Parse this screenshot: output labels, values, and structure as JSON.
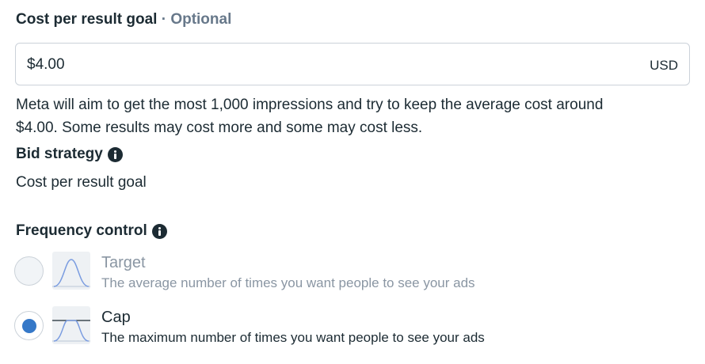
{
  "cost_goal": {
    "label": "Cost per result goal",
    "separator": "·",
    "optional": "Optional",
    "value": "$4.00",
    "currency": "USD",
    "help_line1": "Meta will aim to get the most 1,000 impressions and try to keep the average cost around",
    "help_line2": "$4.00. Some results may cost more and some may cost less."
  },
  "bid_strategy": {
    "title": "Bid strategy",
    "value": "Cost per result goal"
  },
  "frequency_control": {
    "title": "Frequency control",
    "options": [
      {
        "title": "Target",
        "description": "The average number of times you want people to see your ads",
        "selected": false,
        "icon": "bell-curve-icon"
      },
      {
        "title": "Cap",
        "description": "The maximum number of times you want people to see your ads",
        "selected": true,
        "icon": "capped-curve-icon"
      }
    ]
  },
  "colors": {
    "text": "#1c2b33",
    "muted": "#67788a",
    "accent": "#3578c8",
    "curve": "#7a9ce0"
  }
}
